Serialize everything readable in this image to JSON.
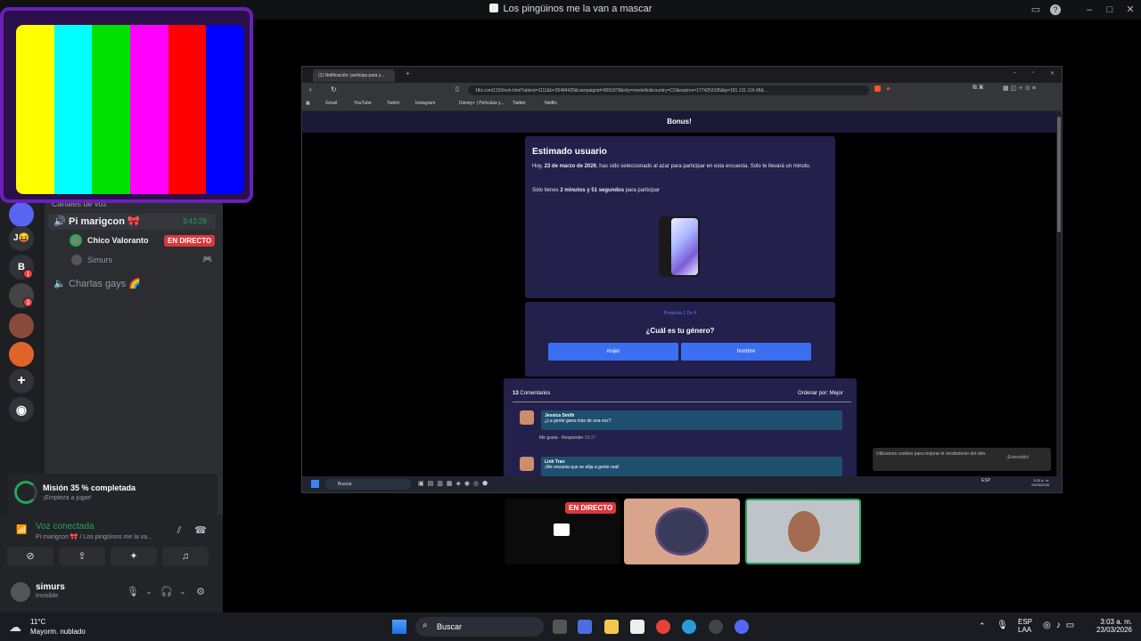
{
  "window": {
    "title": "Los pingüinos me la van a mascar"
  },
  "overlay": {
    "bar_colors": [
      "#ffff00",
      "#00ffff",
      "#00e000",
      "#ff00ff",
      "#ff0000",
      "#0000ff"
    ]
  },
  "servers": [
    {
      "label": "J😝"
    },
    {
      "label": "B",
      "badge": "1"
    },
    {
      "label": "",
      "badge": "3"
    }
  ],
  "channels": {
    "category": "Canales de voz",
    "voice1": {
      "name": "Pi marigcon 🎀",
      "timer": "3:43:29"
    },
    "users": [
      {
        "name": "Chico Valoranto",
        "live": "EN DIRECTO"
      },
      {
        "name": "Simurs"
      }
    ],
    "voice2": {
      "name": "Charlas gays 🌈"
    }
  },
  "mission": {
    "title": "Misión 35 % completada",
    "subtitle": "¡Empieza a jugar!"
  },
  "voice_status": {
    "title": "Voz conectada",
    "subtitle": "Pi marigcon 🎀 / Los pingüinos me la va..."
  },
  "user": {
    "name": "simurs",
    "status": "Invisible"
  },
  "browser": {
    "tab_title": "(1) Notificación: participa para y...",
    "url": "1fkt.com/1153/esh.html?abtest=1111&b=25484420&campaignid=9051878&city=medellin&country=CO&expires=1774253195&ip=181.131.116.48&...",
    "bookmarks": [
      "Gmail",
      "YouTube",
      "Twitch",
      "Instagram",
      "Disney+ | Películas y...",
      "Twitter",
      "Netflix"
    ],
    "header": "Bonus!",
    "card1": {
      "title": "Estimado usuario",
      "p1a": "Hoy, ",
      "p1date": "23 de marzo de 2026",
      "p1b": ", has sido seleccionado al azar para participar en esta encuesta. Solo te llevará un minuto.",
      "p2a": "Solo tienes ",
      "p2time": "2 minutos y 51 segundos",
      "p2b": " para participar"
    },
    "card2": {
      "step": "Pregunta 1 De 4",
      "question": "¿Cuál es tu género?",
      "opt1": "mujer",
      "opt2": "hombre"
    },
    "comments": {
      "count": "13",
      "label": "Comentarios",
      "sort": "Ordenar por: Mejor",
      "items": [
        {
          "author": "Jessica Smith",
          "text": "¿La gente gana más de una vez?",
          "actions": "Me gusta · Responder",
          "time": "09:37"
        },
        {
          "author": "Linh Tran",
          "text": "¡Me encanta que se elija a gente real!"
        }
      ]
    },
    "cookie": {
      "text": "Utilizamos cookies para mejorar el rendimiento del sitio.",
      "button": "¡Entendido!"
    },
    "taskbar_search": "Buscar",
    "tray": {
      "lang": "ESP",
      "time": "3:03 a. m.",
      "date": "23/03/2026"
    }
  },
  "tiles": {
    "live": "EN DIRECTO"
  },
  "taskbar": {
    "weather_temp": "11°C",
    "weather_desc": "Mayorm. nublado",
    "search": "Buscar",
    "lang1": "ESP",
    "lang2": "LAA",
    "time": "3:03 a. m.",
    "date": "23/03/2026"
  }
}
